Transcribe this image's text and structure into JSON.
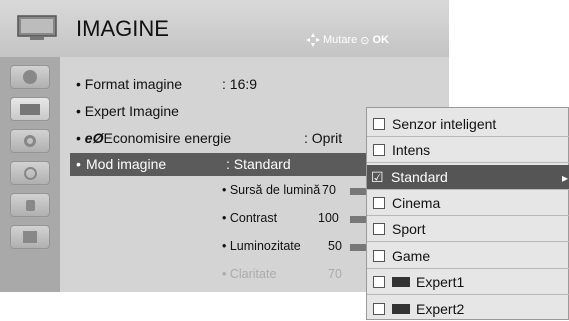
{
  "header": {
    "title": "IMAGINE",
    "hint_move": "Mutare",
    "hint_ok": "OK"
  },
  "menu": {
    "aspect_label": "Format imagine",
    "aspect_value": ": 16:9",
    "expert_label": "Expert Imagine",
    "eco_label": "Economisire energie",
    "eco_value": ": Oprit",
    "mode_label": "Mod imagine",
    "mode_value": ": Standard"
  },
  "settings": [
    {
      "label": "• Sursă de lumină",
      "value": "70",
      "level": 70
    },
    {
      "label": "• Contrast",
      "value": "100",
      "level": 100
    },
    {
      "label": "• Luminozitate",
      "value": "50",
      "level": 50
    },
    {
      "label": "• Claritate",
      "value": "70",
      "level": 70
    }
  ],
  "dropdown": {
    "items": [
      "Senzor inteligent",
      "Intens",
      "Standard",
      "Cinema",
      "Sport",
      "Game",
      "Expert1",
      "Expert2"
    ],
    "selected": "Standard"
  }
}
